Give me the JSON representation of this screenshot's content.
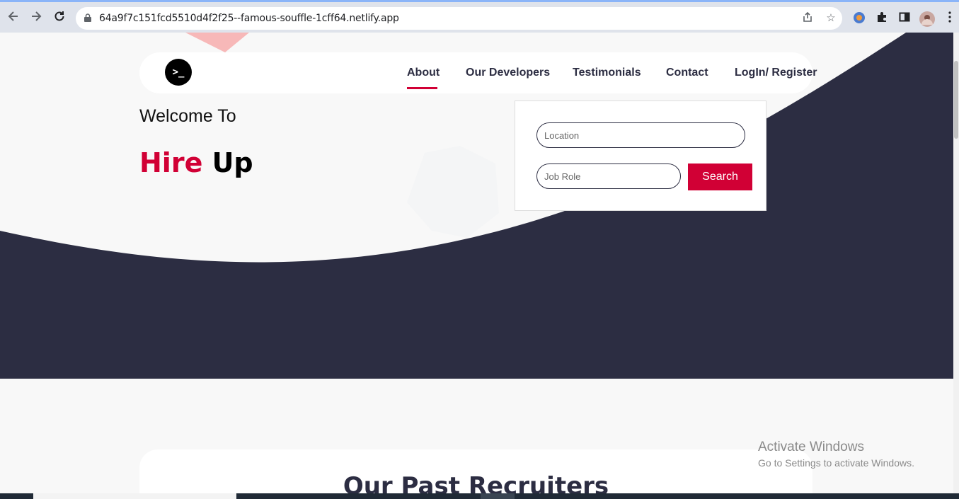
{
  "browser": {
    "url": "64a9f7c151fcd5510d4f2f25--famous-souffle-1cff64.netlify.app",
    "icons": {
      "back": "back-arrow-icon",
      "forward": "forward-arrow-icon",
      "reload": "reload-icon",
      "lock": "lock-icon",
      "share": "share-icon",
      "bookmark": "star-icon",
      "extension": "puzzle-icon",
      "sidepanel": "side-panel-icon",
      "menu": "kebab-menu-icon"
    }
  },
  "site": {
    "logo_symbol": ">_",
    "nav": [
      {
        "label": "About",
        "active": true
      },
      {
        "label": "Our Developers",
        "active": false
      },
      {
        "label": "Testimonials",
        "active": false
      },
      {
        "label": "Contact",
        "active": false
      },
      {
        "label": "LogIn/ Register",
        "active": false
      }
    ],
    "hero": {
      "welcome": "Welcome To",
      "brand_first": "Hire",
      "brand_second": "Up"
    },
    "search": {
      "location_placeholder": "Location",
      "role_placeholder": "Job Role",
      "button": "Search"
    },
    "recruiters": {
      "title": "Our Past Recruiters"
    }
  },
  "watermark": {
    "line1": "Activate Windows",
    "line2": "Go to Settings to activate Windows."
  },
  "colors": {
    "accent": "#d10035",
    "navy": "#2c2d42",
    "page_bg": "#f8f8f8"
  }
}
